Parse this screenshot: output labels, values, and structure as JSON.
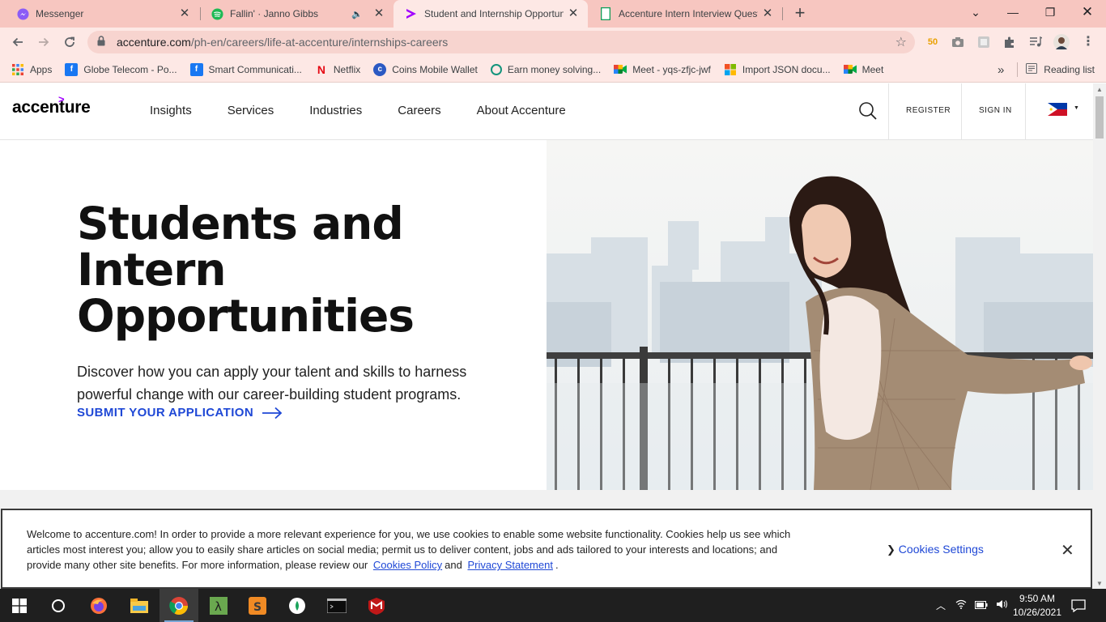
{
  "browser": {
    "tabs": [
      {
        "title": "Messenger",
        "icon": "messenger-icon"
      },
      {
        "title": "Fallin' · Janno Gibbs",
        "icon": "spotify-icon",
        "audio": "🔈"
      },
      {
        "title": "Student and Internship Opportun",
        "icon": "accenture-icon",
        "active": true
      },
      {
        "title": "Accenture Intern Interview Quest",
        "icon": "sheets-icon"
      }
    ],
    "url": {
      "host": "accenture.com",
      "path": "/ph-en/careers/life-at-accenture/internships-careers"
    },
    "bookmarks": [
      {
        "label": "Apps",
        "icon": "apps-grid-icon"
      },
      {
        "label": "Globe Telecom - Po...",
        "icon": "facebook-icon"
      },
      {
        "label": "Smart Communicati...",
        "icon": "facebook-icon"
      },
      {
        "label": "Netflix",
        "icon": "netflix-icon"
      },
      {
        "label": "Coins Mobile Wallet",
        "icon": "coins-icon"
      },
      {
        "label": "Earn money solving...",
        "icon": "earn-icon"
      },
      {
        "label": "Meet - yqs-zfjc-jwf",
        "icon": "meet-icon"
      },
      {
        "label": "Import JSON docu...",
        "icon": "microsoft-icon"
      },
      {
        "label": "Meet",
        "icon": "meet-icon"
      }
    ],
    "overflow_label": "»",
    "reading_list": "Reading list"
  },
  "site": {
    "logo": "accenture",
    "nav": [
      "Insights",
      "Services",
      "Industries",
      "Careers",
      "About Accenture"
    ],
    "register": "REGISTER",
    "sign_in": "SIGN IN",
    "hero": {
      "title_line1": "Students and Intern",
      "title_line2": "Opportunities",
      "subtitle": "Discover how you can apply your talent and skills to harness powerful change with our career-building student programs.",
      "cta": "SUBMIT YOUR APPLICATION"
    }
  },
  "cookie_banner": {
    "text": "Welcome to accenture.com! In order to provide a more relevant experience for you, we use cookies to enable some website functionality. Cookies help us see which articles most interest you; allow you to easily share articles on social media; permit us to deliver content, jobs and ads tailored to your interests and locations; and provide many other site benefits. For more information, please review our",
    "cookies_policy": "Cookies Policy",
    "and": "and",
    "privacy": "Privacy Statement",
    "period": ".",
    "settings": "Cookies Settings",
    "close": "✕"
  },
  "taskbar": {
    "time": "9:50 AM",
    "date": "10/26/2021"
  },
  "colors": {
    "accent_purple": "#a100ff",
    "link_blue": "#1f48d6",
    "tabstrip": "#f7c6c0",
    "toolbar": "#fde8e5"
  }
}
